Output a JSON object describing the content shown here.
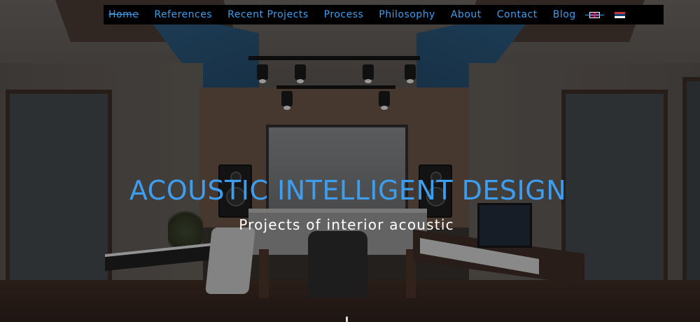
{
  "navbar": {
    "items": [
      {
        "label": "Home",
        "active": true
      },
      {
        "label": "References"
      },
      {
        "label": "Recent Projects"
      },
      {
        "label": "Process"
      },
      {
        "label": "Philosophy"
      },
      {
        "label": "About"
      },
      {
        "label": "Contact"
      },
      {
        "label": "Blog"
      }
    ],
    "languages": [
      {
        "icon": "uk-flag-icon",
        "active": true
      },
      {
        "icon": "serbia-flag-icon"
      }
    ]
  },
  "hero": {
    "title": "ACOUSTIC INTELLIGENT DESIGN",
    "subtitle": "Projects of interior acoustic",
    "background": "recording-studio-photo"
  },
  "colors": {
    "accent": "#3d9ef0",
    "navbar_bg": "#000000",
    "subtitle": "#ffffff"
  }
}
